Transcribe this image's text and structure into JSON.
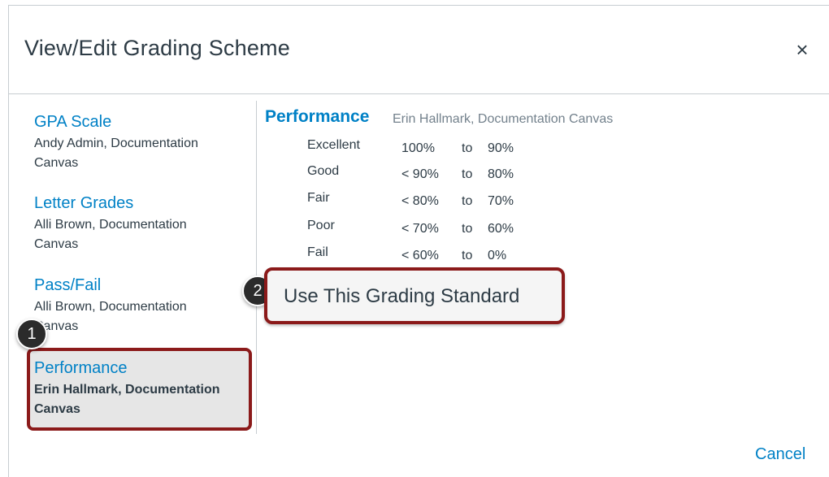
{
  "dialog": {
    "title": "View/Edit Grading Scheme",
    "close_glyph": "×",
    "cancel_label": "Cancel"
  },
  "schemes": [
    {
      "name": "GPA Scale",
      "owner_line1": "Andy Admin, Documentation",
      "owner_line2": "Canvas"
    },
    {
      "name": "Letter Grades",
      "owner_line1": "Alli Brown, Documentation",
      "owner_line2": "Canvas"
    },
    {
      "name": "Pass/Fail",
      "owner_line1": "Alli Brown, Documentation",
      "owner_line2": "Canvas"
    },
    {
      "name": "Performance",
      "owner_line1": "Erin Hallmark, Documentation",
      "owner_line2": "Canvas",
      "selected": true
    }
  ],
  "detail": {
    "name": "Performance",
    "owner": "Erin Hallmark, Documentation Canvas",
    "rows": [
      {
        "label": "Excellent",
        "high": "100%",
        "to": "to",
        "low": "90%"
      },
      {
        "label": "Good",
        "high": "< 90%",
        "to": "to",
        "low": "80%"
      },
      {
        "label": "Fair",
        "high": "< 80%",
        "to": "to",
        "low": "70%"
      },
      {
        "label": "Poor",
        "high": "< 70%",
        "to": "to",
        "low": "60%"
      },
      {
        "label": "Fail",
        "high": "< 60%",
        "to": "to",
        "low": "0%"
      }
    ],
    "use_button_label": "Use This Grading Standard"
  },
  "callouts": {
    "first": "1",
    "second": "2"
  },
  "colors": {
    "link": "#0081c6",
    "highlight_border": "#8b1a1a",
    "badge": "#2b2b2b"
  }
}
